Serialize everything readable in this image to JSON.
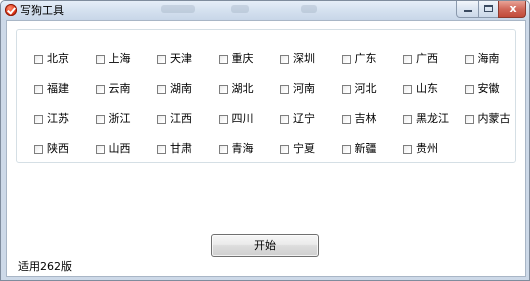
{
  "window": {
    "title": "写狗工具",
    "close_glyph": "x"
  },
  "provinces": [
    "北京",
    "上海",
    "天津",
    "重庆",
    "深圳",
    "广东",
    "广西",
    "海南",
    "福建",
    "云南",
    "湖南",
    "湖北",
    "河南",
    "河北",
    "山东",
    "安徽",
    "江苏",
    "浙江",
    "江西",
    "四川",
    "辽宁",
    "吉林",
    "黑龙江",
    "内蒙古",
    "陕西",
    "山西",
    "甘肃",
    "青海",
    "宁夏",
    "新疆",
    "贵州"
  ],
  "actions": {
    "start_label": "开始"
  },
  "footer": {
    "version_text": "适用262版"
  },
  "colors": {
    "client_background": "#ffffff",
    "frame": "#cdd9e8",
    "close_button": "#c24a3a"
  }
}
